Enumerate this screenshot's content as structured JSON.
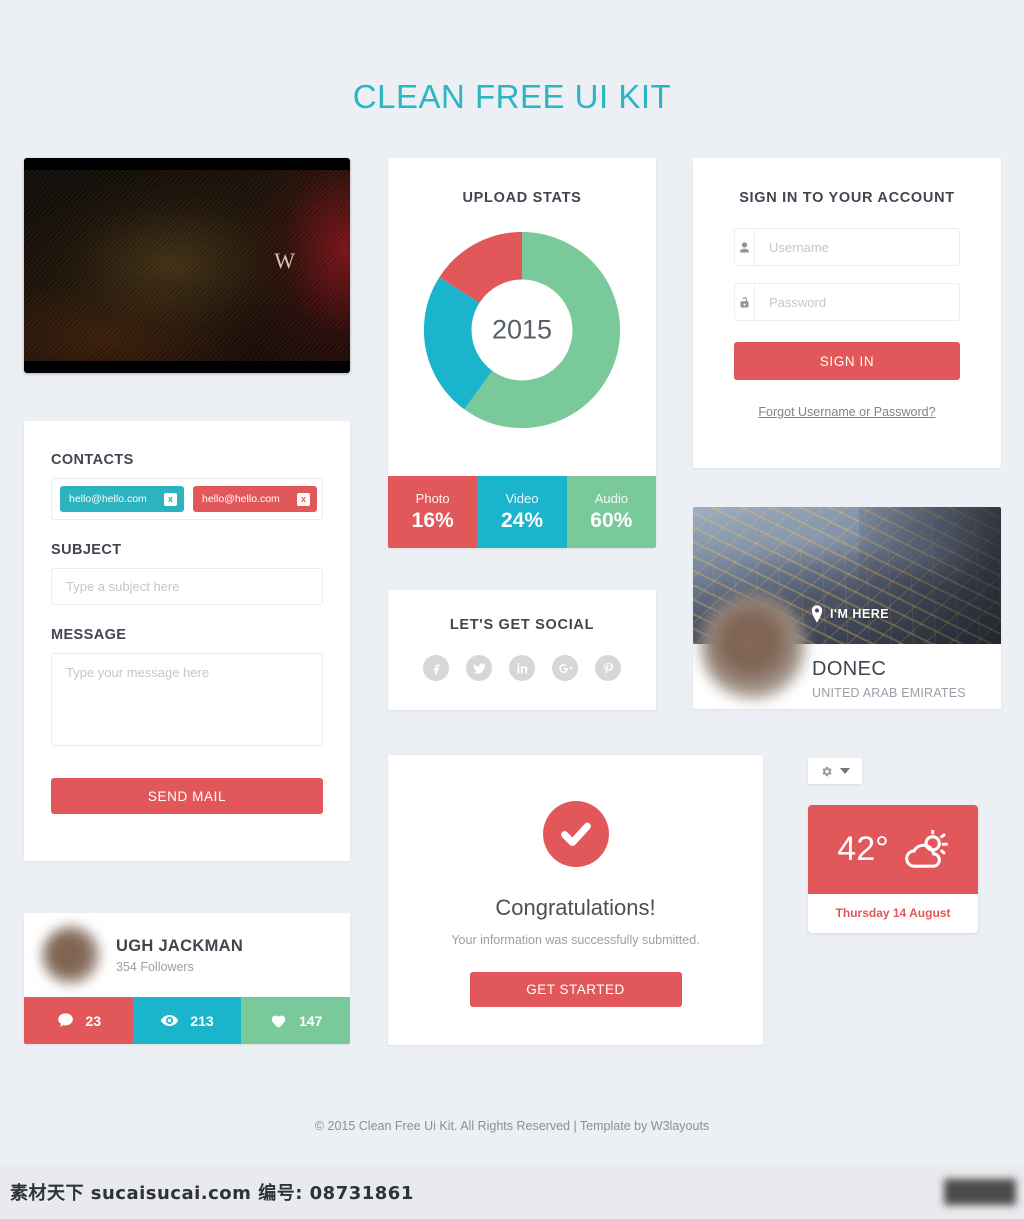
{
  "page": {
    "title": "CLEAN FREE UI KIT",
    "accent_teal": "#2cb5c6",
    "accent_red": "#e2585a",
    "accent_green": "#79c99a",
    "background": "#eceff3"
  },
  "video": {
    "logo": "W"
  },
  "contact": {
    "contacts_label": "CONTACTS",
    "tags": [
      {
        "email": "hello@hello.com",
        "color": "#2bb3c0",
        "remove": "x"
      },
      {
        "email": "hello@hello.com",
        "color": "#e2585a",
        "remove": "x"
      }
    ],
    "subject_label": "SUBJECT",
    "subject_placeholder": "Type a subject here",
    "subject_value": "",
    "message_label": "MESSAGE",
    "message_placeholder": "Type your message here",
    "message_value": "",
    "send_label": "SEND MAIL"
  },
  "profile": {
    "name": "UGH JACKMAN",
    "followers": "354 Followers",
    "stats": [
      {
        "icon": "comment-icon",
        "value": "23",
        "color": "#e2585a"
      },
      {
        "icon": "eye-icon",
        "value": "213",
        "color": "#1bb4cd"
      },
      {
        "icon": "heart-icon",
        "value": "147",
        "color": "#79c99a"
      }
    ]
  },
  "upload": {
    "heading": "UPLOAD STATS",
    "center_label": "2015"
  },
  "chart_data": {
    "type": "pie",
    "title": "UPLOAD STATS",
    "center_label": "2015",
    "categories": [
      "Photo",
      "Video",
      "Audio"
    ],
    "values": [
      16,
      24,
      60
    ],
    "value_labels": [
      "16%",
      "24%",
      "60%"
    ],
    "colors": [
      "#e2585a",
      "#1bb4cd",
      "#79c99a"
    ],
    "unit": "%",
    "donut": true,
    "inner_radius_ratio": 0.55,
    "start_angle_deg": 0,
    "direction": "clockwise",
    "legend_position": "bottom",
    "grid": false
  },
  "social": {
    "heading": "LET'S GET SOCIAL",
    "icons": [
      {
        "name": "facebook-icon",
        "label": "f"
      },
      {
        "name": "twitter-icon",
        "label": "t"
      },
      {
        "name": "linkedin-icon",
        "label": "in"
      },
      {
        "name": "googleplus-icon",
        "label": "g+"
      },
      {
        "name": "pinterest-icon",
        "label": "p"
      }
    ]
  },
  "congrats": {
    "title": "Congratulations!",
    "subtitle": "Your information was successfully submitted.",
    "button": "GET STARTED"
  },
  "signin": {
    "heading": "SIGN IN TO YOUR ACCOUNT",
    "username_placeholder": "Username",
    "username_value": "",
    "password_placeholder": "Password",
    "password_value": "",
    "button": "SIGN IN",
    "forgot": "Forgot Username or Password?"
  },
  "location": {
    "marker": "I'M HERE",
    "city": "DONEC",
    "country": "UNITED ARAB EMIRATES"
  },
  "weather": {
    "temperature": "42°",
    "date": "Thursday 14 August",
    "icon": "sun-cloud-icon"
  },
  "footer": {
    "text": "© 2015 Clean Free Ui Kit. All Rights Reserved | Template by W3layouts"
  },
  "watermark": {
    "text": "素材天下 sucaisucai.com  编号: 08731861"
  }
}
